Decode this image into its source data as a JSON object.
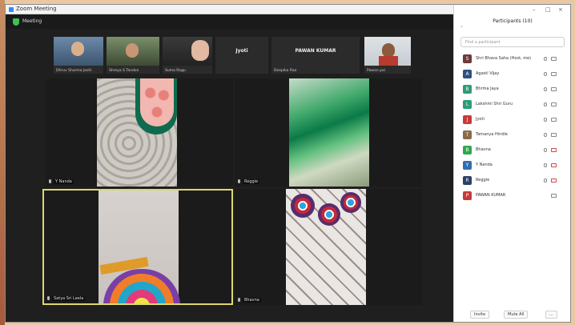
{
  "window": {
    "title": "Zoom Meeting",
    "view_label": "Meeting"
  },
  "strip": [
    {
      "name": "Dhruv Sharma Joshi"
    },
    {
      "name": "Shreya S Tandon"
    },
    {
      "name": "Suma Ragu"
    },
    {
      "name": "",
      "text": "Jyoti"
    },
    {
      "name": "Deepika Rao",
      "text": "PAWAN KUMAR"
    },
    {
      "name": "Pawan pal"
    }
  ],
  "tiles": [
    {
      "name": "Y Nanda"
    },
    {
      "name": "Reggie"
    },
    {
      "name": "Satya Sri Leela"
    },
    {
      "name": "Bhavna"
    }
  ],
  "panel": {
    "title": "Participants (10)",
    "search_placeholder": "Find a participant",
    "participants": [
      {
        "name": "Shri Bhava Saha (Host, me)",
        "initial": "S",
        "color": "#6b3a3a",
        "video_off": false
      },
      {
        "name": "Agasti Vijay",
        "initial": "A",
        "color": "#2f4f7f",
        "video_off": false
      },
      {
        "name": "Bhrma Jaya",
        "initial": "B",
        "color": "#2e9c74",
        "video_off": false
      },
      {
        "name": "Lakshmi Shri Guru",
        "initial": "L",
        "color": "#2e9c74",
        "video_off": false
      },
      {
        "name": "Jyoti",
        "initial": "J",
        "color": "#c73a3a",
        "video_off": false
      },
      {
        "name": "Tamanya Hindle",
        "initial": "T",
        "color": "#8a6a4a",
        "video_off": false
      },
      {
        "name": "Bhavna",
        "initial": "B",
        "color": "#2ea94e",
        "video_off": true
      },
      {
        "name": "Y Nanda",
        "initial": "Y",
        "color": "#2f6fb0",
        "video_off": true
      },
      {
        "name": "Reggie",
        "initial": "R",
        "color": "#2c3f66",
        "video_off": true
      },
      {
        "name": "PAWAN KUMAR",
        "initial": "P",
        "color": "#c73a3a",
        "video_off": false
      }
    ],
    "invite_label": "Invite",
    "mute_all_label": "Mute All",
    "more_label": "..."
  }
}
